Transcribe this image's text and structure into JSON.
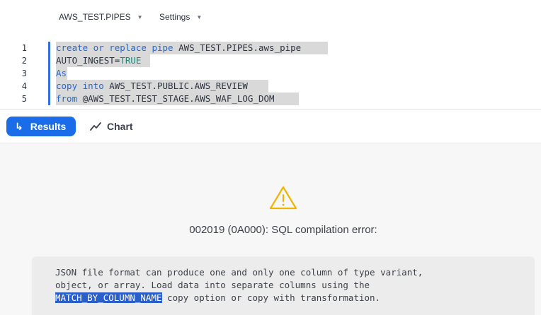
{
  "toolbar": {
    "context_label": "AWS_TEST.PIPES",
    "settings_label": "Settings"
  },
  "editor": {
    "lines": [
      {
        "number": "1",
        "tokens": [
          {
            "t": "create or replace pipe",
            "c": "kw"
          },
          {
            "t": " AWS_TEST.PIPES.aws_pipe",
            "c": ""
          }
        ]
      },
      {
        "number": "2",
        "tokens": [
          {
            "t": "AUTO_INGEST=",
            "c": ""
          },
          {
            "t": "TRUE",
            "c": "ps"
          }
        ]
      },
      {
        "number": "3",
        "tokens": [
          {
            "t": "As",
            "c": "kw"
          }
        ]
      },
      {
        "number": "4",
        "tokens": [
          {
            "t": "copy into",
            "c": "kw"
          },
          {
            "t": " AWS_TEST.PUBLIC.AWS_REVIEW",
            "c": ""
          }
        ]
      },
      {
        "number": "5",
        "tokens": [
          {
            "t": "from",
            "c": "kw"
          },
          {
            "t": " @AWS_TEST.TEST_STAGE.AWS_WAF_LOG_DOM",
            "c": ""
          }
        ]
      }
    ]
  },
  "tabs": {
    "results_label": "Results",
    "chart_label": "Chart"
  },
  "error": {
    "title": "002019 (0A000): SQL compilation error:",
    "message_before": "JSON file format can produce one and only one column of type variant,\nobject, or array. Load data into separate columns using the\n",
    "message_selected": "MATCH_BY_COLUMN_NAME",
    "message_after": " copy option or copy with transformation."
  },
  "colors": {
    "accent": "#1a6ce8",
    "keyword": "#2368d3",
    "warning": "#f0b400"
  }
}
